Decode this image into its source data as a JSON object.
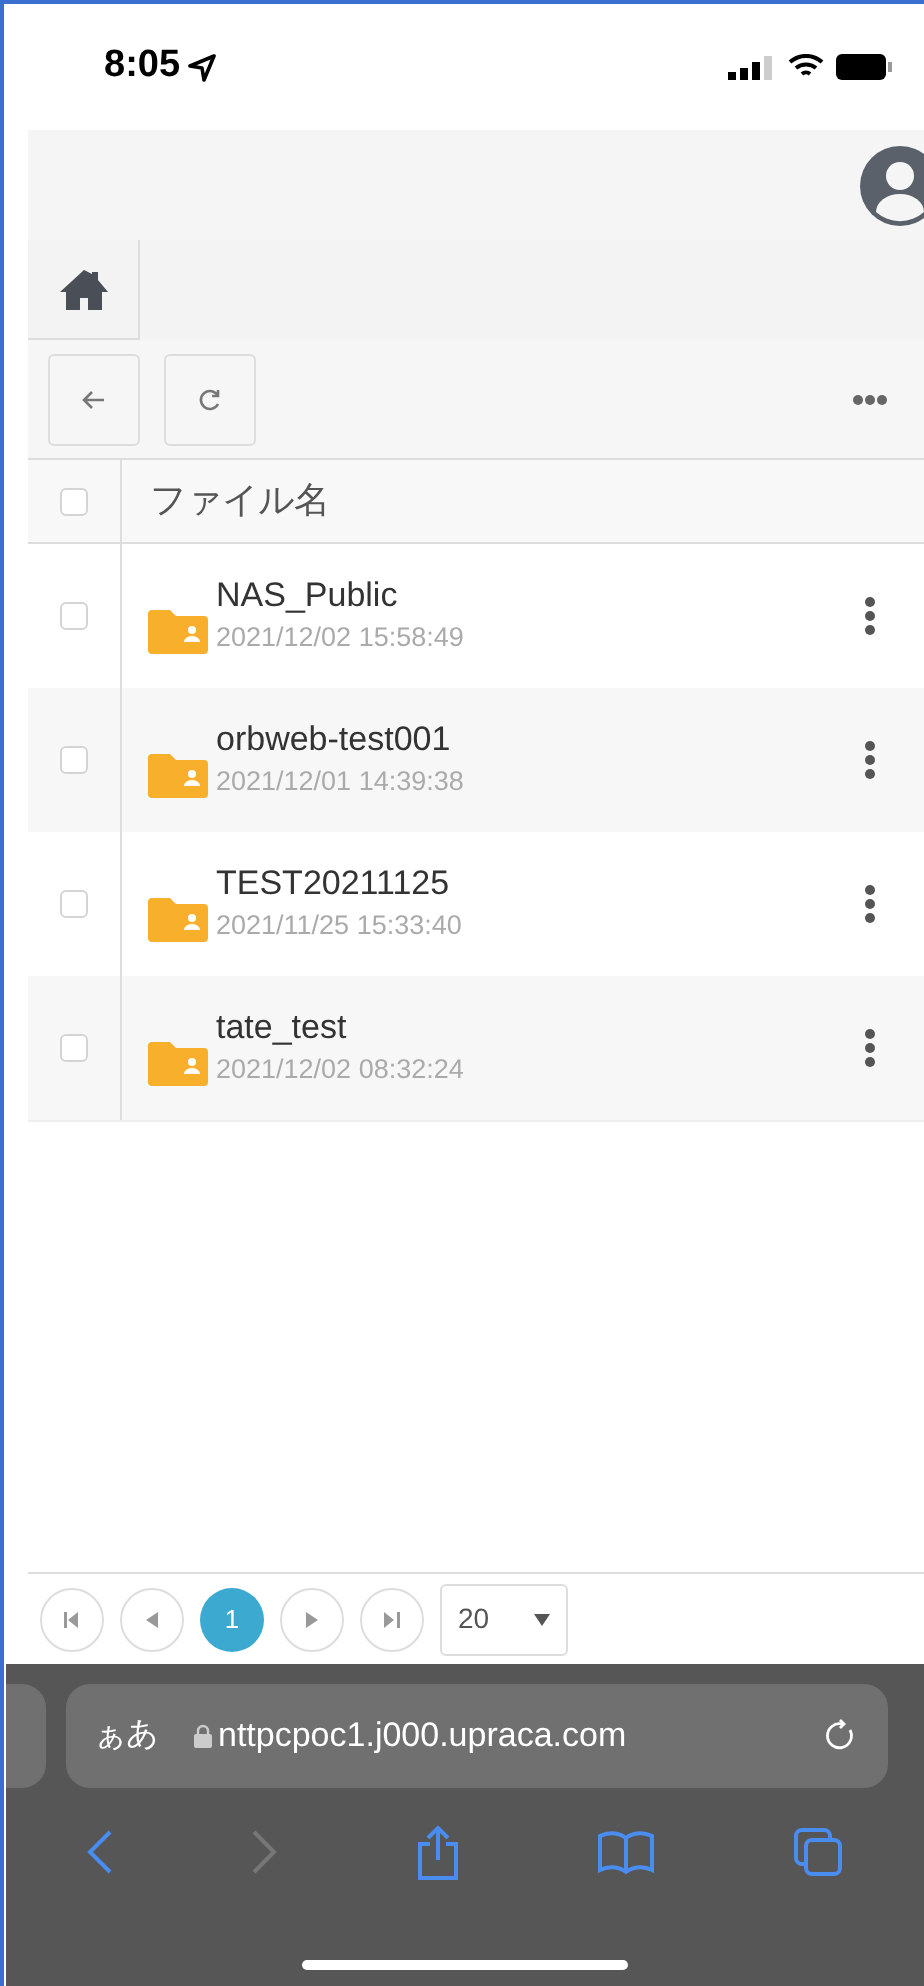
{
  "status_bar": {
    "time": "8:05"
  },
  "file_table": {
    "select_all": {
      "checked": false
    },
    "columns": [
      "ファイル名"
    ],
    "rows": [
      {
        "name": "NAS_Public",
        "modified": "2021/12/02 15:58:49",
        "checked": false
      },
      {
        "name": "orbweb-test001",
        "modified": "2021/12/01 14:39:38",
        "checked": false
      },
      {
        "name": "TEST20211125",
        "modified": "2021/11/25 15:33:40",
        "checked": false
      },
      {
        "name": "tate_test",
        "modified": "2021/12/02 08:32:24",
        "checked": false
      }
    ]
  },
  "pagination": {
    "pages": [
      {
        "label": "1",
        "selected": true
      }
    ],
    "page_size": "20"
  },
  "browser": {
    "text_size": "ぁあ",
    "url": "nttpcpoc1.j000.upraca.com",
    "back_disabled": false,
    "forward_disabled": true
  }
}
